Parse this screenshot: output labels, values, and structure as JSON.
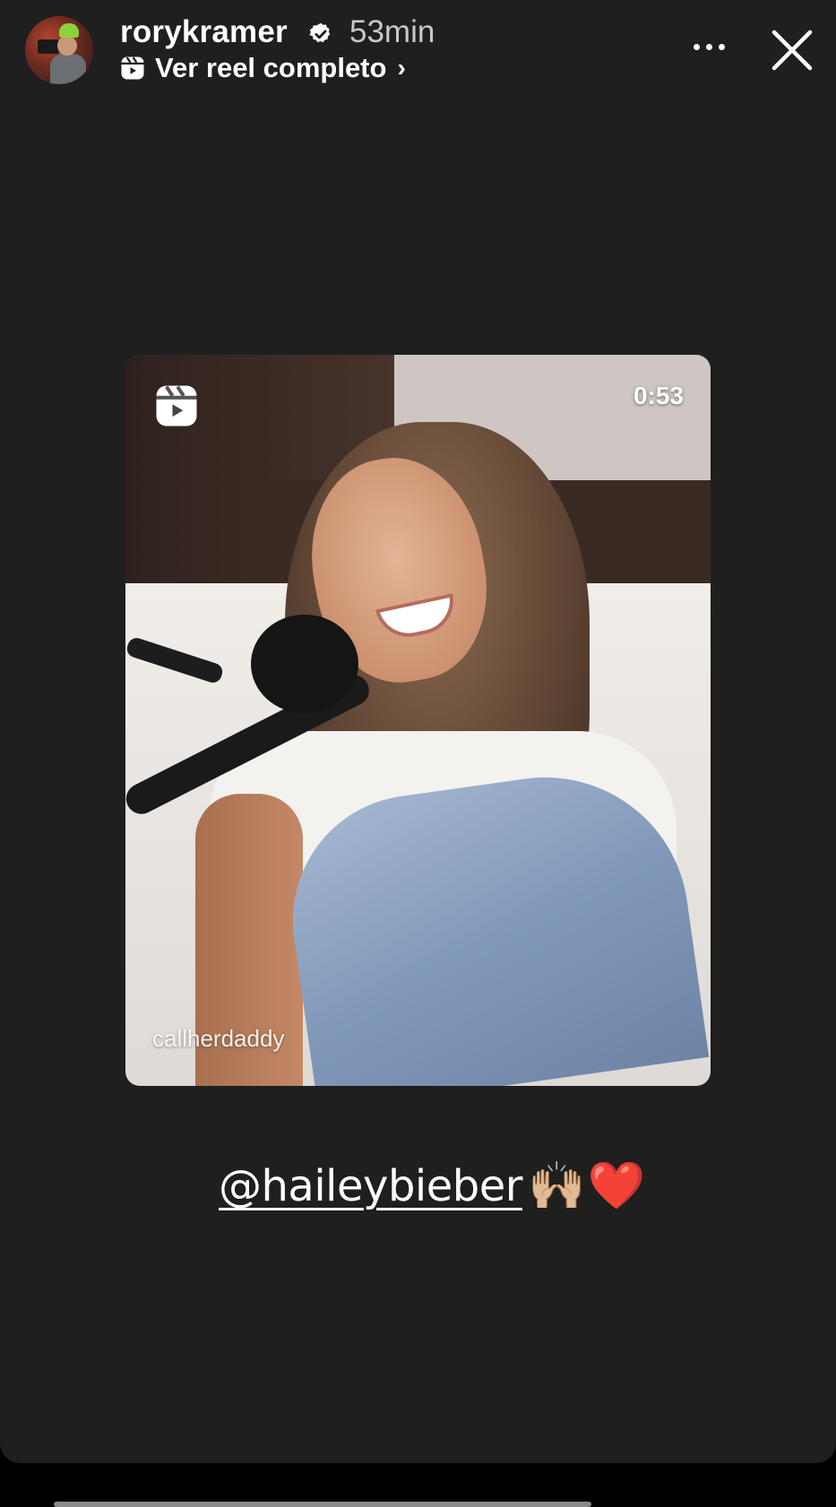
{
  "story": {
    "username": "rorykramer",
    "time_ago": "53min",
    "reel_link_label": "Ver reel completo",
    "reel_link_chevron": "›",
    "verified_icon": "verified-badge-icon",
    "more_icon": "more-horizontal-icon",
    "close_icon": "close-icon"
  },
  "reel": {
    "duration": "0:53",
    "watermark": "callherdaddy",
    "reel_icon": "reels-icon"
  },
  "mention": {
    "handle": "@haileybieber",
    "emoji_1": "🙌🏼",
    "emoji_2": "❤️"
  },
  "colors": {
    "background": "#1f1f20",
    "text": "#ffffff",
    "muted": "#c8c8c8"
  }
}
